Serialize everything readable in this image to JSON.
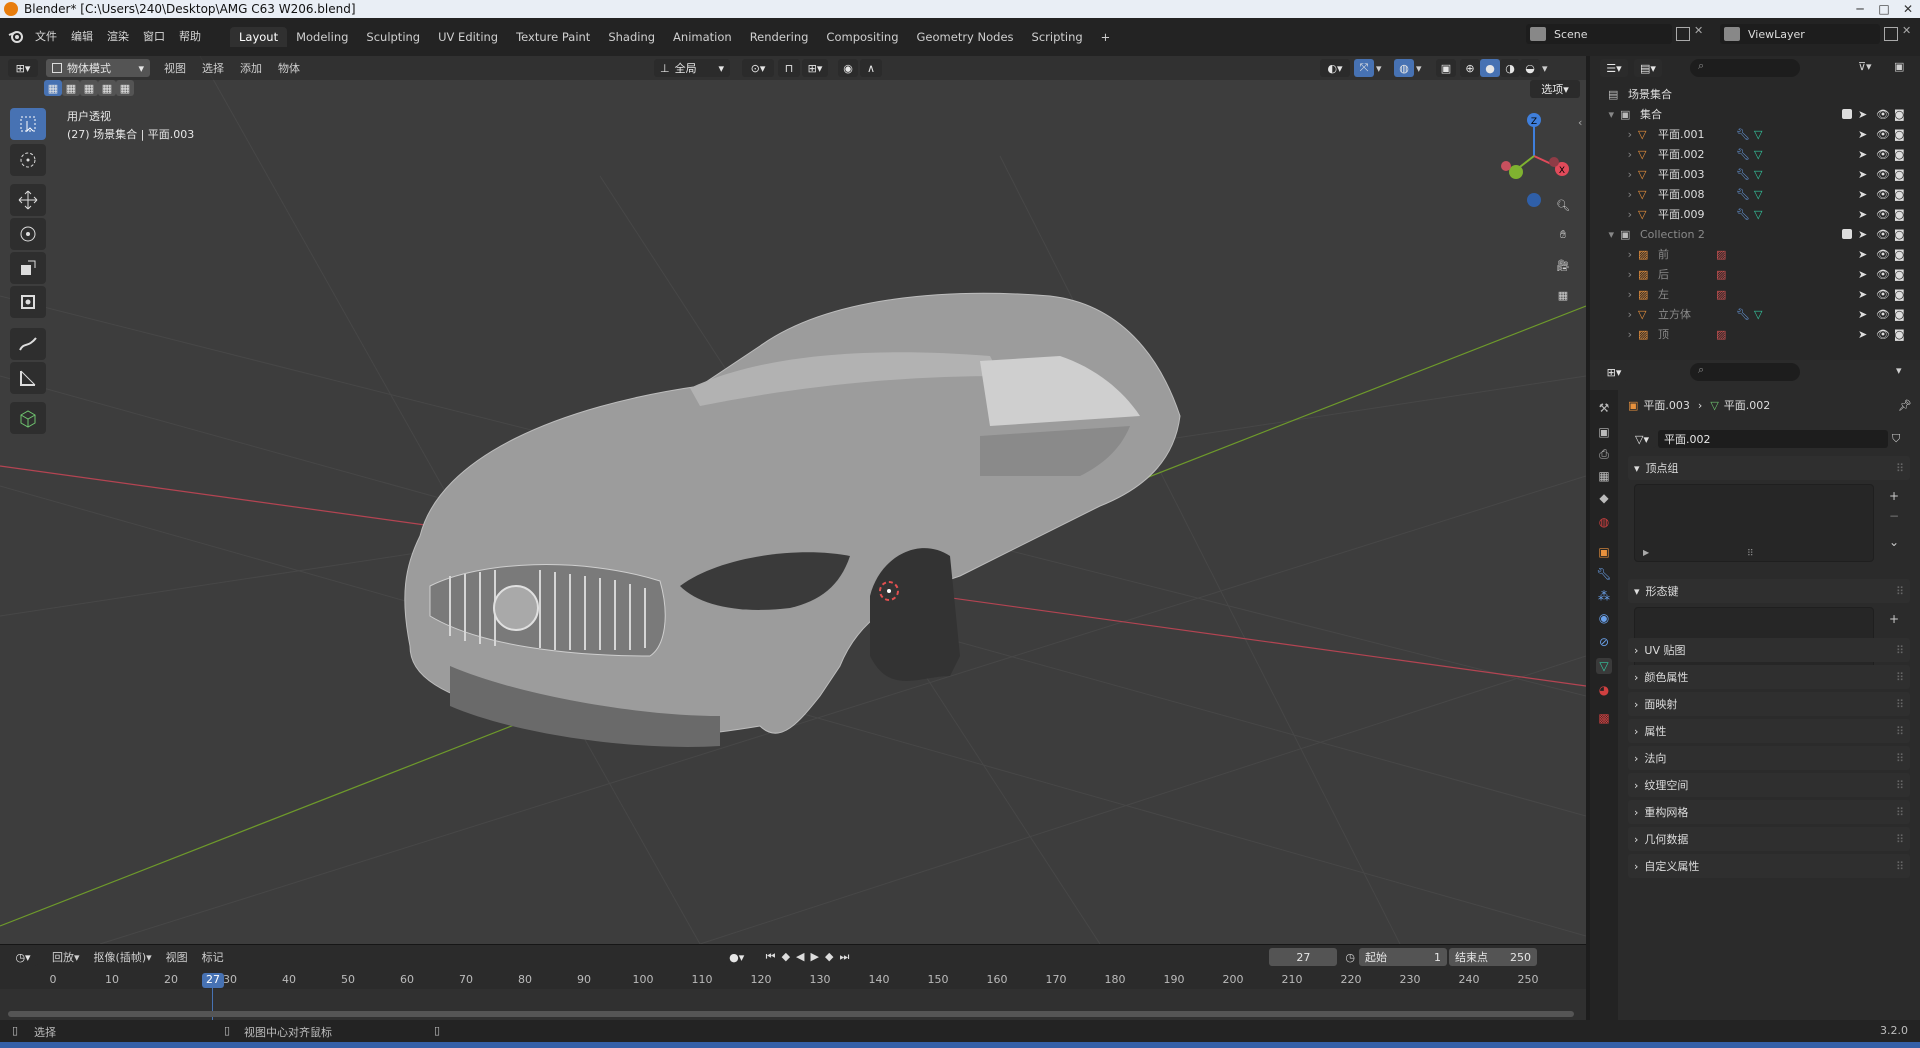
{
  "window": {
    "title": "Blender* [C:\\Users\\240\\Desktop\\AMG C63 W206.blend]"
  },
  "menu": [
    "文件",
    "编辑",
    "渲染",
    "窗口",
    "帮助"
  ],
  "workspaces": [
    "Layout",
    "Modeling",
    "Sculpting",
    "UV Editing",
    "Texture Paint",
    "Shading",
    "Animation",
    "Rendering",
    "Compositing",
    "Geometry Nodes",
    "Scripting",
    "+"
  ],
  "active_workspace": "Layout",
  "scene": {
    "name": "Scene",
    "view_layer": "ViewLayer"
  },
  "viewport": {
    "mode": "物体模式",
    "menus": [
      "视图",
      "选择",
      "添加",
      "物体"
    ],
    "transform_orientation": "全局",
    "options_label": "选项",
    "view_name": "用户透视",
    "context": "(27) 场景集合 | 平面.003",
    "gizmo_axes": {
      "x": "X",
      "y": "Y",
      "z": "Z"
    }
  },
  "outliner": {
    "root": "场景集合",
    "collection1": "集合",
    "items1": [
      "平面.001",
      "平面.002",
      "平面.003",
      "平面.008",
      "平面.009"
    ],
    "collection2": "Collection 2",
    "items2": [
      "前",
      "后",
      "左",
      "立方体",
      "顶"
    ]
  },
  "properties": {
    "breadcrumb_object": "平面.003",
    "breadcrumb_data": "平面.002",
    "mesh_name": "平面.002",
    "panels_open": [
      "顶点组",
      "形态键"
    ],
    "panels_closed": [
      "UV 贴图",
      "颜色属性",
      "面映射",
      "属性",
      "法向",
      "纹理空间",
      "重构网格",
      "几何数据",
      "自定义属性"
    ]
  },
  "timeline": {
    "menus": [
      "回放",
      "抠像(插帧)",
      "视图",
      "标记"
    ],
    "current_frame": "27",
    "start_label": "起始",
    "start": "1",
    "end_label": "结束点",
    "end": "250",
    "ticks": [
      "0",
      "10",
      "20",
      "30",
      "40",
      "50",
      "60",
      "70",
      "80",
      "90",
      "100",
      "110",
      "120",
      "130",
      "140",
      "150",
      "160",
      "170",
      "180",
      "190",
      "200",
      "210",
      "220",
      "230",
      "240",
      "250"
    ]
  },
  "status": {
    "left": "选择",
    "middle": "视图中心对齐鼠标",
    "version": "3.2.0"
  },
  "colors": {
    "accent": "#4772b3",
    "x_axis": "#e04a5a",
    "y_axis": "#7fb230",
    "z_axis": "#3f7fdc",
    "object_orange": "#e8913d"
  }
}
